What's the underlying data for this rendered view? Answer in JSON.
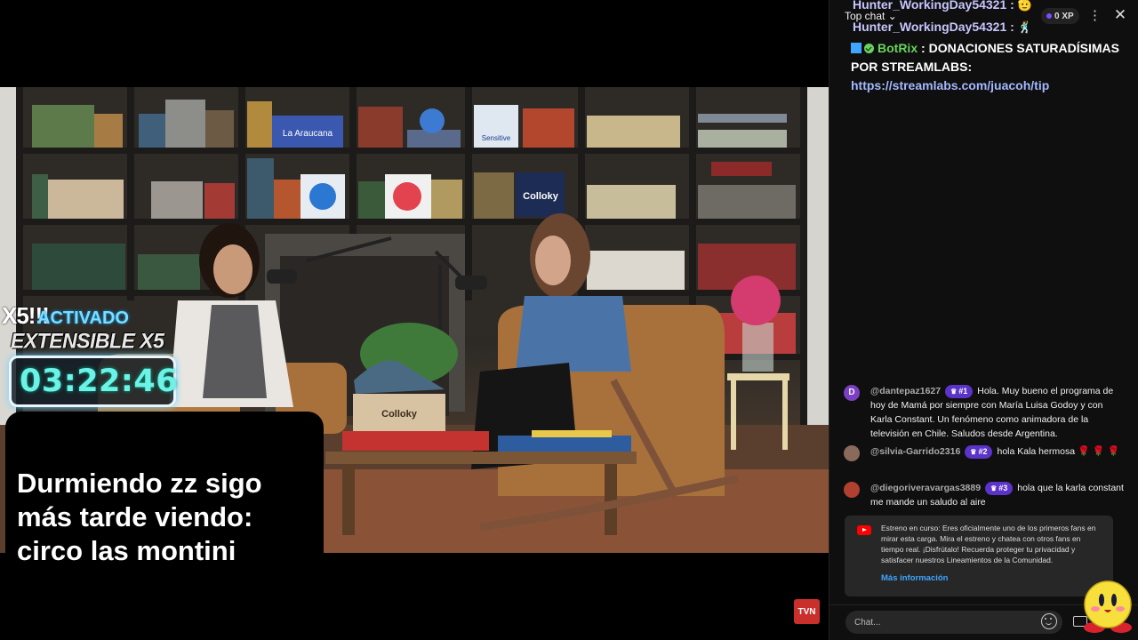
{
  "overlay": {
    "x5": "X5!!!",
    "activado": "ACTIVADO",
    "extensible": "EXTENSIBLE X5",
    "timer": "03:22:46",
    "note": "Durmiendo zz sigo más tarde viendo: circo las montini"
  },
  "video": {
    "brand_logo": "TVN",
    "signs": {
      "araucana": "La Araucana",
      "sensitive": "Sensitive",
      "colloky_shelf": "Colloky",
      "colloky_box": "Colloky"
    }
  },
  "chat": {
    "header": {
      "mode": "Top chat",
      "xp": "0 XP"
    },
    "top_messages": [
      {
        "author": "Hunter_WorkingDay54321 :",
        "emoji": "🫡"
      },
      {
        "author": "Hunter_WorkingDay54321 :",
        "emoji": "🕺"
      }
    ],
    "pinned": {
      "bot": "BotRix",
      "sep": " : ",
      "text": "DONACIONES SATURADÍSIMAS POR STREAMLABS: ",
      "link": "https://streamlabs.com/juacoh/tip"
    },
    "messages": [
      {
        "avatar_letter": "D",
        "avatar_color": "#7b3fc4",
        "author": "@dantepaz1627",
        "rank": "#1",
        "text": "Hola. Muy bueno el programa de hoy de Mamá por siempre con María Luisa Godoy y con Karla Constant. Un fenómeno como animadora de la televisión en Chile. Saludos desde Argentina."
      },
      {
        "avatar_letter": "",
        "avatar_color": "#8a6a5a",
        "author": "@silvia-Garrido2316",
        "rank": "#2",
        "text": "hola Kala hermosa ",
        "emoji": "🌹 🌹 🌹"
      },
      {
        "avatar_letter": "",
        "avatar_color": "#b04030",
        "author": "@diegoriveravargas3889",
        "rank": "#3",
        "text": "hola que la karla constant me mande un saludo al aire"
      }
    ],
    "notice": {
      "text": "Estreno en curso: Eres oficialmente uno de los primeros fans en mirar esta carga. Mira el estreno y chatea con otros fans en tiempo real. ¡Disfrútalo! Recuerda proteger tu privacidad y satisfacer nuestros Lineamientos de la Comunidad.",
      "link": "Más información"
    },
    "input": {
      "placeholder": "Chat..."
    }
  },
  "colors": {
    "chat_bg": "#0f0f0f",
    "rank_badge": "#5b33c9",
    "timer": "#6cf2e6",
    "link": "#3ea6ff"
  }
}
